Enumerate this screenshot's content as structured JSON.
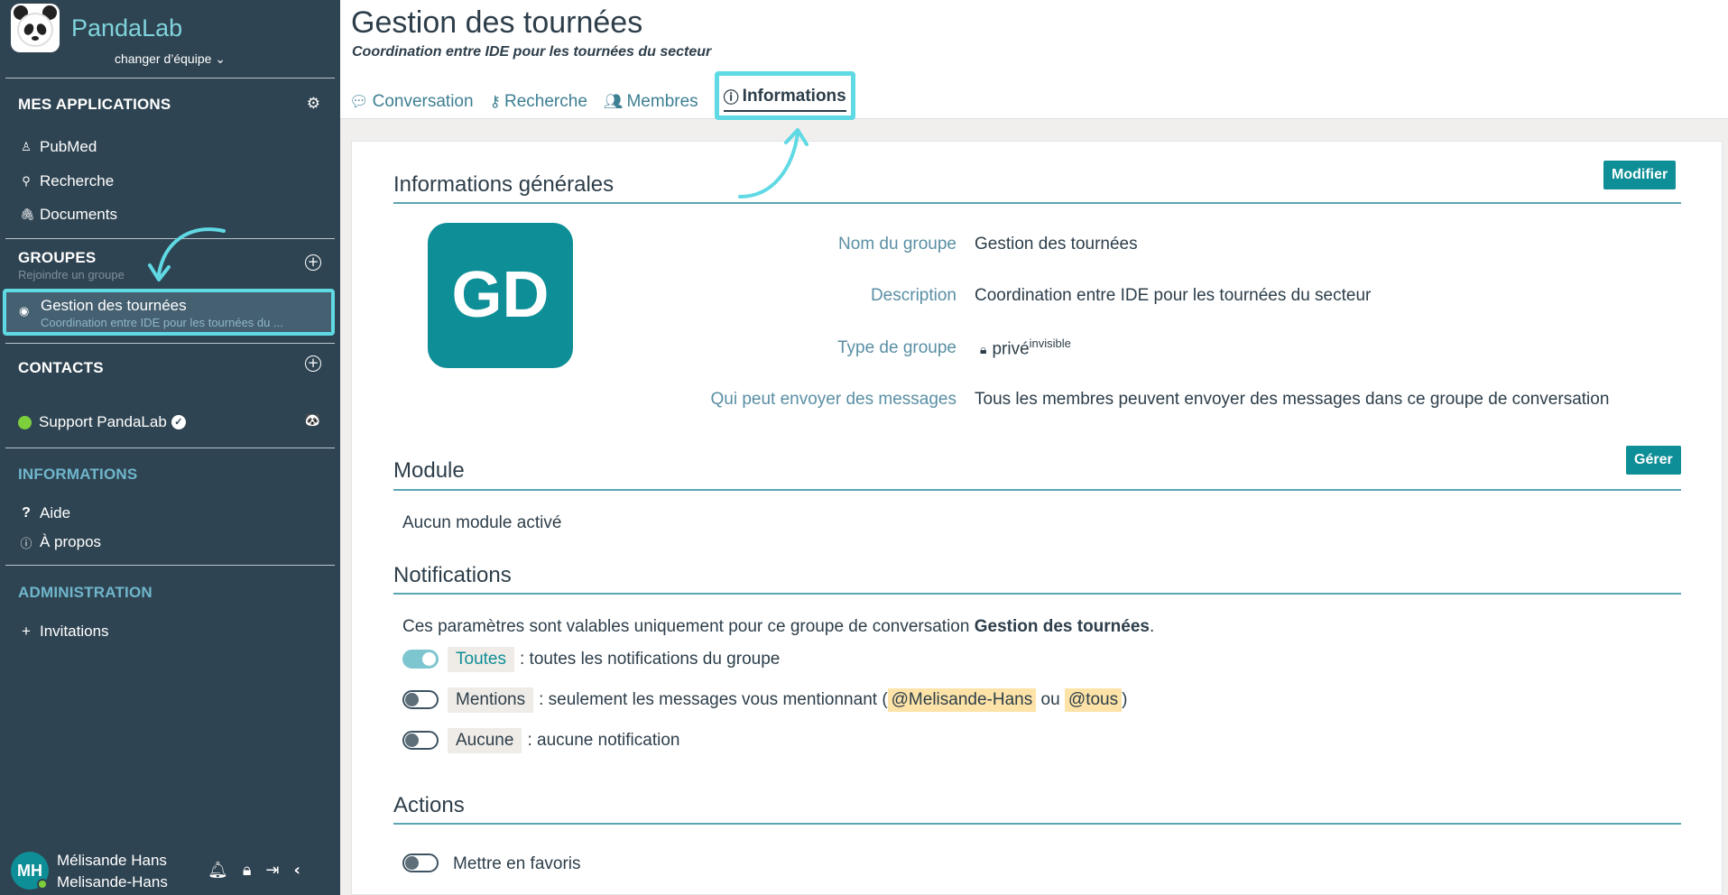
{
  "sidebar": {
    "brand": "PandaLab",
    "team_switch": "changer d’équipe",
    "apps_title": "MES APPLICATIONS",
    "apps": [
      {
        "label": "PubMed",
        "icon": "user-icon"
      },
      {
        "label": "Recherche",
        "icon": "search-icon"
      },
      {
        "label": "Documents",
        "icon": "paperclip-icon"
      }
    ],
    "groups_title": "GROUPES",
    "groups_join": "Rejoindre un groupe",
    "active_group": {
      "name": "Gestion des tournées",
      "desc": "Coordination entre IDE pour les tournées du ..."
    },
    "contacts_title": "CONTACTS",
    "contact": "Support PandaLab",
    "info_title": "INFORMATIONS",
    "info_items": [
      {
        "label": "Aide",
        "icon": "question-icon"
      },
      {
        "label": "À propos",
        "icon": "info-icon"
      }
    ],
    "admin_title": "ADMINISTRATION",
    "admin_items": [
      {
        "label": "Invitations",
        "icon": "plus-icon"
      }
    ],
    "user": {
      "initials": "MH",
      "name": "Mélisande Hans",
      "handle": "Melisande-Hans"
    }
  },
  "header": {
    "title": "Gestion des tournées",
    "subtitle": "Coordination entre IDE pour les tournées du secteur",
    "tabs": [
      {
        "label": "Conversation",
        "icon": "chat-icon"
      },
      {
        "label": "Recherche",
        "icon": "key-icon"
      },
      {
        "label": "Membres",
        "icon": "members-icon"
      },
      {
        "label": "Informations",
        "icon": "info-icon",
        "active": true
      }
    ]
  },
  "general": {
    "title": "Informations générales",
    "edit_button": "Modifier",
    "logo_initials": "GD",
    "rows": [
      {
        "label": "Nom du groupe",
        "value": "Gestion des tournées"
      },
      {
        "label": "Description",
        "value": "Coordination entre IDE pour les tournées du secteur"
      },
      {
        "label": "Type de groupe",
        "value": "privé",
        "sup": "invisible"
      },
      {
        "label": "Qui peut envoyer des messages",
        "value": "Tous les membres peuvent envoyer des messages dans ce groupe de conversation"
      }
    ]
  },
  "module": {
    "title": "Module",
    "manage_button": "Gérer",
    "empty": "Aucun module activé"
  },
  "notifications": {
    "title": "Notifications",
    "intro_prefix": "Ces paramètres sont valables uniquement pour ce groupe de conversation ",
    "intro_group": "Gestion des tournées",
    "intro_suffix": ".",
    "options": [
      {
        "chip": "Toutes",
        "text": ": toutes les notifications du groupe",
        "on": true
      },
      {
        "chip": "Mentions",
        "text_before": ": seulement les messages vous mentionnant (",
        "mention1": "@Melisande-Hans",
        "mid": " ou ",
        "mention2": "@tous",
        "text_after": ")",
        "on": false
      },
      {
        "chip": "Aucune",
        "text": ": aucune notification",
        "on": false
      }
    ]
  },
  "actions": {
    "title": "Actions",
    "favorite": "Mettre en favoris",
    "favorite_on": false
  },
  "colors": {
    "sidebar_bg": "#2f4452",
    "accent": "#0e8e96",
    "highlight": "#5fd9e3",
    "brand": "#7fd3dc"
  }
}
